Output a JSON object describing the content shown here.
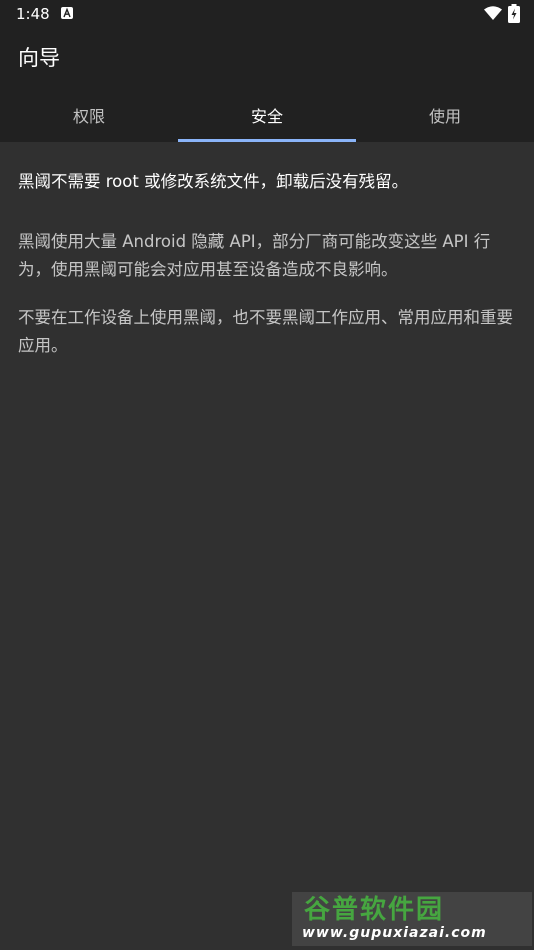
{
  "status_bar": {
    "time": "1:48",
    "notification_icon": "a-icon",
    "wifi_icon": "wifi-icon",
    "battery_icon": "battery-charging-icon"
  },
  "app_bar": {
    "title": "向导"
  },
  "tabs": [
    {
      "label": "权限",
      "active": false
    },
    {
      "label": "安全",
      "active": true
    },
    {
      "label": "使用",
      "active": false
    }
  ],
  "content": {
    "lead": "黑阈不需要 root 或修改系统文件，卸载后没有残留。",
    "paragraph_1": "黑阈使用大量 Android 隐藏 API，部分厂商可能改变这些 API 行为，使用黑阈可能会对应用甚至设备造成不良影响。",
    "paragraph_2": "不要在工作设备上使用黑阈，也不要黑阈工作应用、常用应用和重要应用。"
  },
  "watermark": {
    "logo": "谷普软件园",
    "url": "www.gupuxiazai.com"
  },
  "colors": {
    "background": "#303030",
    "app_bar": "#212121",
    "indicator": "#8ab4f8",
    "watermark_green": "#46a640"
  }
}
